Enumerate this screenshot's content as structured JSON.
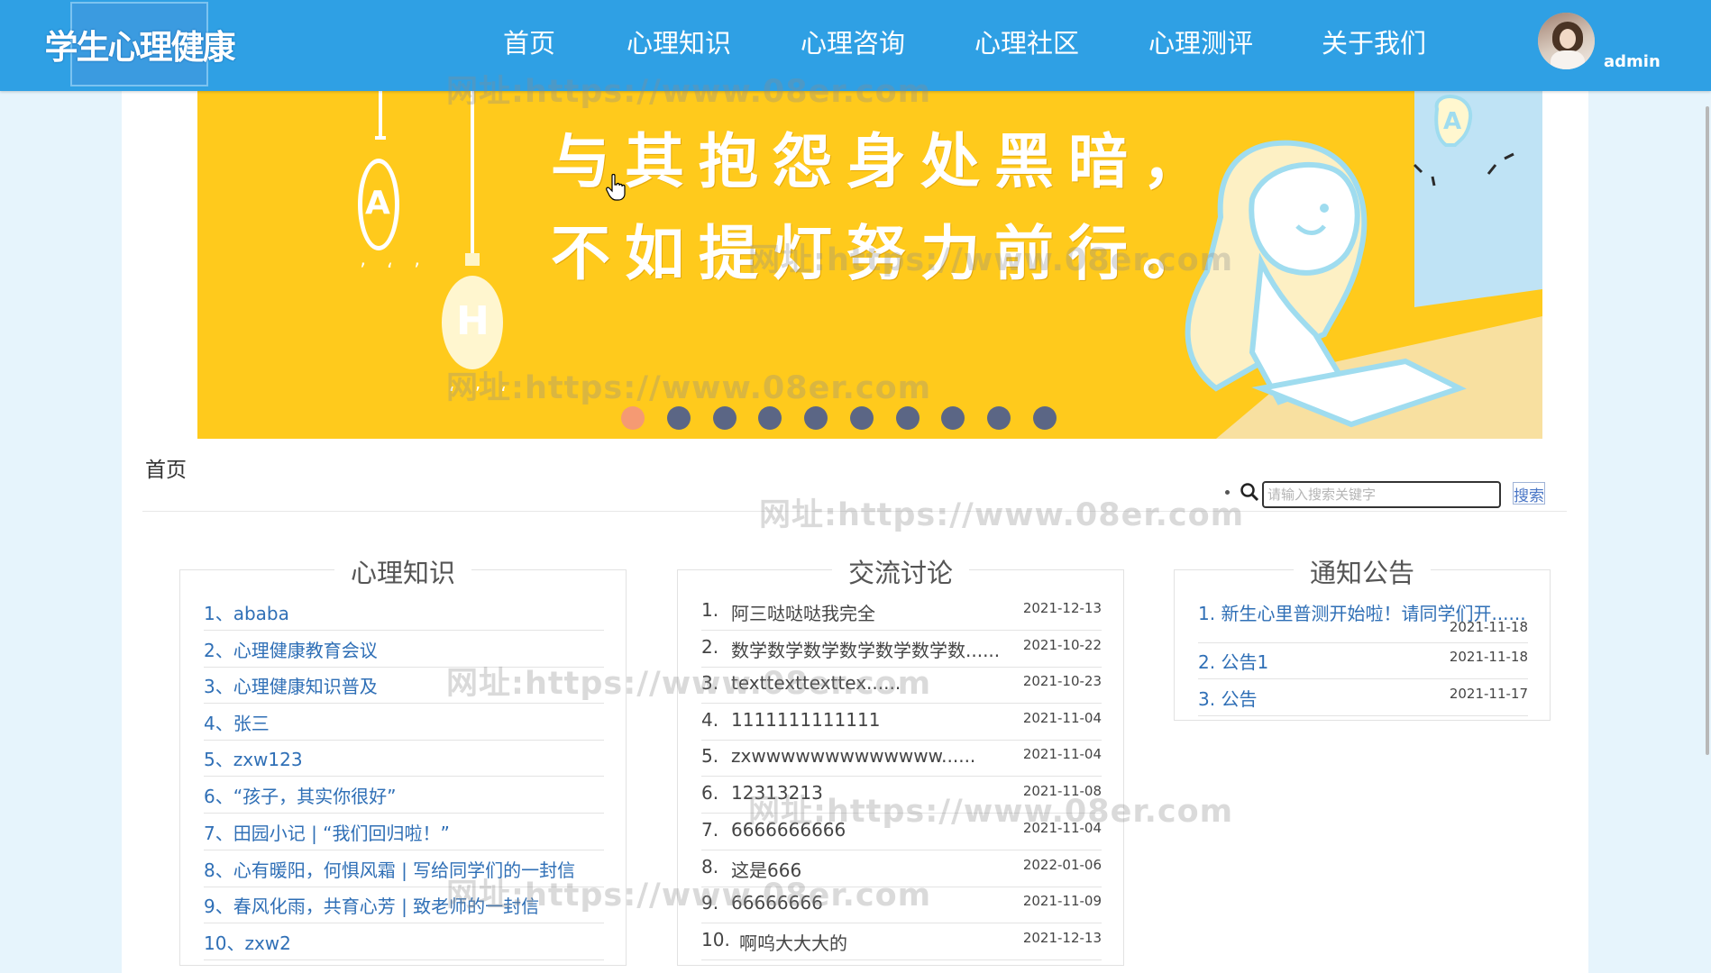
{
  "header": {
    "logo_text": "学生心理健康",
    "nav": [
      "首页",
      "心理知识",
      "心理咨询",
      "心理社区",
      "心理测评",
      "关于我们"
    ],
    "user": "admin"
  },
  "banner": {
    "line1": "与其抱怨身处黑暗，",
    "line2": "不如提灯努力前行。",
    "slides": 10,
    "active_slide": 1
  },
  "breadcrumb": "首页",
  "search": {
    "placeholder": "请输入搜索关键字",
    "button": "搜索"
  },
  "knowledge": {
    "title": "心理知识",
    "items": [
      "1、ababa",
      "2、心理健康教育会议",
      "3、心理健康知识普及",
      "4、张三",
      "5、zxw123",
      "6、“孩子，其实你很好”",
      "7、田园小记 | “我们回归啦！”",
      "8、心有暖阳，何惧风霜 | 写给同学们的一封信",
      "9、春风化雨，共育心芳 | 致老师的一封信",
      "10、zxw2"
    ]
  },
  "discussion": {
    "title": "交流讨论",
    "items": [
      {
        "num": "1.",
        "text": "阿三哒哒哒我完全",
        "date": "2021-12-13"
      },
      {
        "num": "2.",
        "text": "数学数学数学数学数学数学数......",
        "date": "2021-10-22"
      },
      {
        "num": "3.",
        "text": "texttexttexttex......",
        "date": "2021-10-23"
      },
      {
        "num": "4.",
        "text": "1111111111111",
        "date": "2021-11-04"
      },
      {
        "num": "5.",
        "text": "zxwwwwwwwwwwwww......",
        "date": "2021-11-04"
      },
      {
        "num": "6.",
        "text": "12313213",
        "date": "2021-11-08"
      },
      {
        "num": "7.",
        "text": "6666666666",
        "date": "2021-11-04"
      },
      {
        "num": "8.",
        "text": "这是666",
        "date": "2022-01-06"
      },
      {
        "num": "9.",
        "text": "66666666",
        "date": "2021-11-09"
      },
      {
        "num": "10.",
        "text": "啊呜大大大的",
        "date": "2021-12-13"
      }
    ]
  },
  "notice": {
    "title": "通知公告",
    "items": [
      {
        "text": "1. 新生心里普测开始啦！请同学们开......",
        "date": "2021-11-18"
      },
      {
        "text": "2. 公告1",
        "date": "2021-11-18"
      },
      {
        "text": "3. 公告",
        "date": "2021-11-17"
      }
    ]
  },
  "watermark": "网址:https://www.08er.com",
  "colors": {
    "header": "#2fa0e4",
    "banner": "#ffca1c",
    "dot": "#5b6685",
    "dot_active": "#f59a73",
    "link": "#2f6fb6"
  }
}
